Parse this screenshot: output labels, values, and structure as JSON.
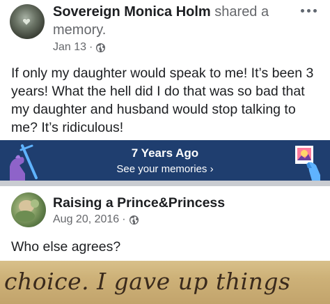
{
  "post1": {
    "author": "Sovereign Monica Holm",
    "action": "shared a memory.",
    "date": "Jan 13",
    "separator": "·",
    "privacy_icon": "globe-icon",
    "text": "If only my daughter would speak to me! It’s been 3 years! What the hell did I do that was so bad that my daughter and husband would stop talking to me? It’s ridiculous!"
  },
  "memories": {
    "title": "7 Years Ago",
    "link": "See your memories",
    "chevron": "›"
  },
  "post2": {
    "author": "Raising a Prince&Princess",
    "date": "Aug 20, 2016",
    "separator": "·",
    "privacy_icon": "globe-icon",
    "text": "Who else agrees?",
    "image_text": "choice. I gave up things"
  },
  "colors": {
    "memories_bg": "#1f3e6f",
    "meta_text": "#65676b",
    "divider": "#c9ccd1"
  }
}
